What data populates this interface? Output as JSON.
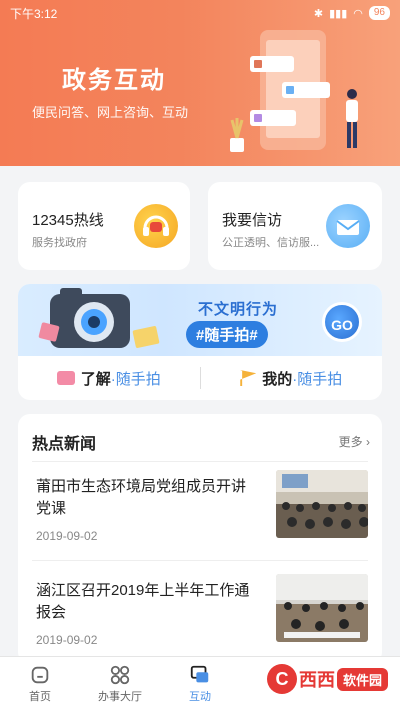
{
  "status_bar": {
    "time": "下午3:12",
    "battery": "96"
  },
  "hero": {
    "title": "政务互动",
    "subtitle": "便民问答、网上咨询、互动"
  },
  "cards": [
    {
      "title": "12345热线",
      "subtitle": "服务找政府",
      "icon": "headset-icon"
    },
    {
      "title": "我要信访",
      "subtitle": "公正透明、信访服...",
      "icon": "mail-icon"
    }
  ],
  "banner": {
    "headline": "不文明行为",
    "hashtag": "#随手拍#",
    "go_label": "GO",
    "left_action": {
      "strong": "了解",
      "light": "·随手拍"
    },
    "right_action": {
      "strong": "我的",
      "light": "·随手拍"
    }
  },
  "news": {
    "title": "热点新闻",
    "more": "更多",
    "items": [
      {
        "headline": "莆田市生态环境局党组成员开讲党课",
        "date": "2019-09-02"
      },
      {
        "headline": "涵江区召开2019年上半年工作通报会",
        "date": "2019-09-02"
      }
    ]
  },
  "tabs": [
    {
      "label": "首页",
      "active": false
    },
    {
      "label": "办事大厅",
      "active": false
    },
    {
      "label": "互动",
      "active": true
    },
    {
      "label": "",
      "active": false
    },
    {
      "label": "",
      "active": false
    }
  ],
  "watermark": {
    "brand": "西西",
    "box": "软件园"
  },
  "colors": {
    "accent": "#4a8fe4",
    "hero": "#f47b54"
  }
}
